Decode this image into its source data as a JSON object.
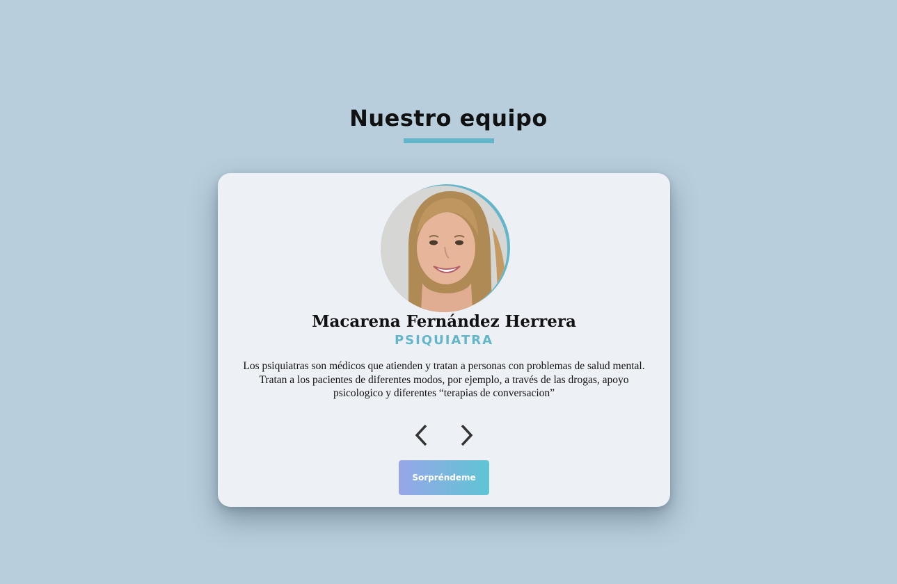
{
  "section": {
    "title": "Nuestro equipo"
  },
  "member": {
    "name": "Macarena Fernández Herrera",
    "role": "PSIQUIATRA",
    "bio": "Los psiquiatras son médicos que atienden y tratan a personas con problemas de salud mental. Tratan a los pacientes de diferentes modos, por ejemplo, a través de las drogas, apoyo psicologico y diferentes “terapias de conversacion”"
  },
  "controls": {
    "prev_icon": "chevron-left-icon",
    "next_icon": "chevron-right-icon",
    "surprise_label": "Sorpréndeme"
  },
  "colors": {
    "background": "#b8cedc",
    "card": "#edf0f5",
    "accent": "#63b6c9",
    "button_gradient_start": "#97a6e8",
    "button_gradient_end": "#5fc5d4"
  }
}
